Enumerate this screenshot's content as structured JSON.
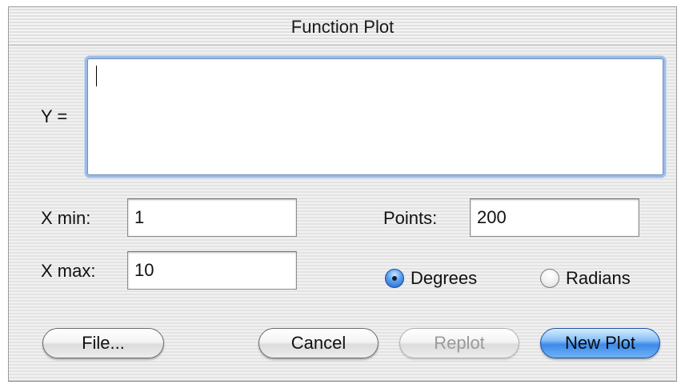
{
  "window": {
    "title": "Function Plot"
  },
  "expression": {
    "label": "Y =",
    "value": ""
  },
  "range": {
    "xmin_label": "X min:",
    "xmin_value": "1",
    "xmax_label": "X max:",
    "xmax_value": "10"
  },
  "points": {
    "label": "Points:",
    "value": "200"
  },
  "angle_mode": {
    "degrees_label": "Degrees",
    "radians_label": "Radians",
    "selected": "Degrees"
  },
  "buttons": {
    "file_label": "File...",
    "cancel_label": "Cancel",
    "replot_label": "Replot",
    "replot_enabled": false,
    "new_plot_label": "New Plot"
  },
  "colors": {
    "default_button": "#3d8ae8",
    "focus_ring": "#9dbbe6"
  },
  "icons": {
    "selected_radio": "radio-selected-icon",
    "unselected_radio": "radio-unselected-icon"
  }
}
